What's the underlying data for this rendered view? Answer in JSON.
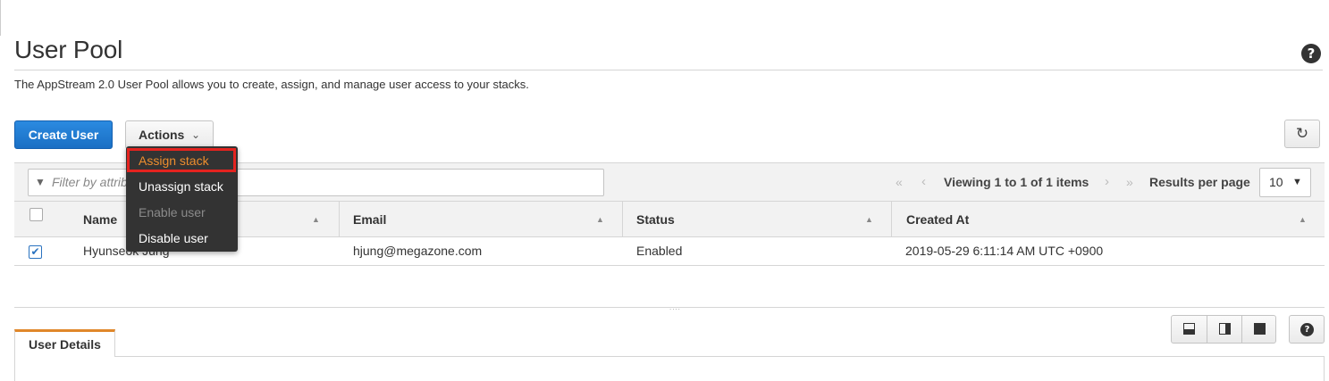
{
  "header": {
    "title": "User Pool",
    "description": "The AppStream 2.0 User Pool allows you to create, assign, and manage user access to your stacks.",
    "help_icon": "?"
  },
  "toolbar": {
    "create_label": "Create User",
    "actions_label": "Actions",
    "actions_chevron": "⌄",
    "refresh_icon": "↻"
  },
  "actions_menu": {
    "items": [
      {
        "label": "Assign stack",
        "state": "highlighted"
      },
      {
        "label": "Unassign stack",
        "state": "enabled"
      },
      {
        "label": "Enable user",
        "state": "disabled"
      },
      {
        "label": "Disable user",
        "state": "enabled"
      }
    ]
  },
  "filter": {
    "placeholder": "Filter by attributes",
    "visible_text": "Filter by attrib",
    "icon": "▼"
  },
  "pagination": {
    "first": "«",
    "prev": "‹",
    "summary": "Viewing 1 to 1 of 1 items",
    "next": "›",
    "last": "»",
    "results_label": "Results per page",
    "results_value": "10",
    "results_caret": "▼"
  },
  "table": {
    "columns": [
      "Name",
      "Email",
      "Status",
      "Created At"
    ],
    "sort_icon": "▲",
    "rows": [
      {
        "selected": true,
        "name": "Hyunseok Jung",
        "email": "hjung@megazone.com",
        "status": "Enabled",
        "created_at": "2019-05-29 6:11:14 AM UTC +0900"
      }
    ]
  },
  "details": {
    "tab_label": "User Details",
    "splitter_glyph": "....",
    "help_icon": "?"
  },
  "colors": {
    "primary": "#1a6fc4",
    "menu_bg": "#333333",
    "menu_highlight_text": "#ec8d2e",
    "highlight_box": "#e4231f",
    "tab_accent": "#e0872a"
  }
}
